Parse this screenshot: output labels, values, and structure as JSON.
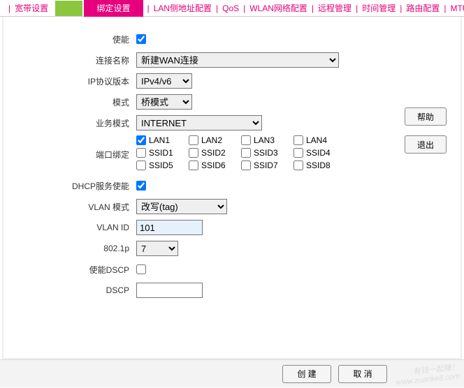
{
  "nav": {
    "items": [
      "宽带设置",
      "绑定设置",
      "LAN侧地址配置",
      "QoS",
      "WLAN网络配置",
      "远程管理",
      "时间管理",
      "路由配置",
      "MTU设置"
    ],
    "active_index": 1
  },
  "labels": {
    "enable": "使能",
    "conn_name": "连接名称",
    "ip_ver": "IP协议版本",
    "mode": "模式",
    "svc_mode": "业务模式",
    "port_bind": "端口绑定",
    "dhcp_enable": "DHCP服务使能",
    "vlan_mode": "VLAN 模式",
    "vlan_id": "VLAN ID",
    "p8021": "802.1p",
    "dscp_enable": "使能DSCP",
    "dscp": "DSCP"
  },
  "values": {
    "enable": true,
    "conn_name": "新建WAN连接",
    "ip_ver": "IPv4/v6",
    "mode": "桥模式",
    "svc_mode": "INTERNET",
    "dhcp_enable": true,
    "vlan_mode": "改写(tag)",
    "vlan_id": "101",
    "p8021": "7",
    "dscp_enable": false,
    "dscp": ""
  },
  "ports": {
    "row1": [
      {
        "label": "LAN1",
        "checked": true
      },
      {
        "label": "LAN2",
        "checked": false
      },
      {
        "label": "LAN3",
        "checked": false
      },
      {
        "label": "LAN4",
        "checked": false
      }
    ],
    "row2": [
      {
        "label": "SSID1",
        "checked": false
      },
      {
        "label": "SSID2",
        "checked": false
      },
      {
        "label": "SSID3",
        "checked": false
      },
      {
        "label": "SSID4",
        "checked": false
      }
    ],
    "row3": [
      {
        "label": "SSID5",
        "checked": false
      },
      {
        "label": "SSID6",
        "checked": false
      },
      {
        "label": "SSID7",
        "checked": false
      },
      {
        "label": "SSID8",
        "checked": false
      }
    ]
  },
  "buttons": {
    "help": "帮助",
    "exit": "退出",
    "create": "创 建",
    "cancel": "取 消"
  },
  "watermark": {
    "l1": "有钱一起赚！",
    "l2": "www.zuanke8.com"
  }
}
